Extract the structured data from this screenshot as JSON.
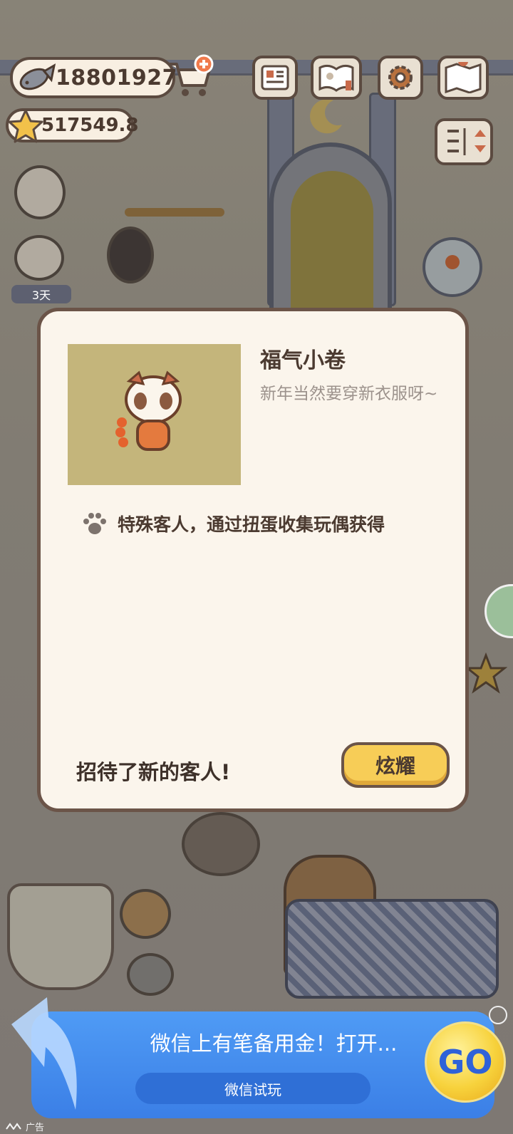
{
  "hud": {
    "fish_currency": "18801927",
    "star_currency": "517549.8",
    "days_badge": "3天"
  },
  "modal": {
    "item_name": "福气小卷",
    "item_description": "新年当然要穿新衣服呀~",
    "source_text": "特殊客人，通过扭蛋收集玩偶获得",
    "greeting": "招待了新的客人!",
    "show_button": "炫耀"
  },
  "ad": {
    "headline": "微信上有笔备用金！打开...",
    "try_button": "微信试玩",
    "go_button": "GO",
    "label": "广告"
  },
  "colors": {
    "modal_bg": "#fbf5ec",
    "thumb_bg": "#c4b57b",
    "button_yellow": "#f7cd57",
    "ad_blue": "#3b7fe6"
  }
}
